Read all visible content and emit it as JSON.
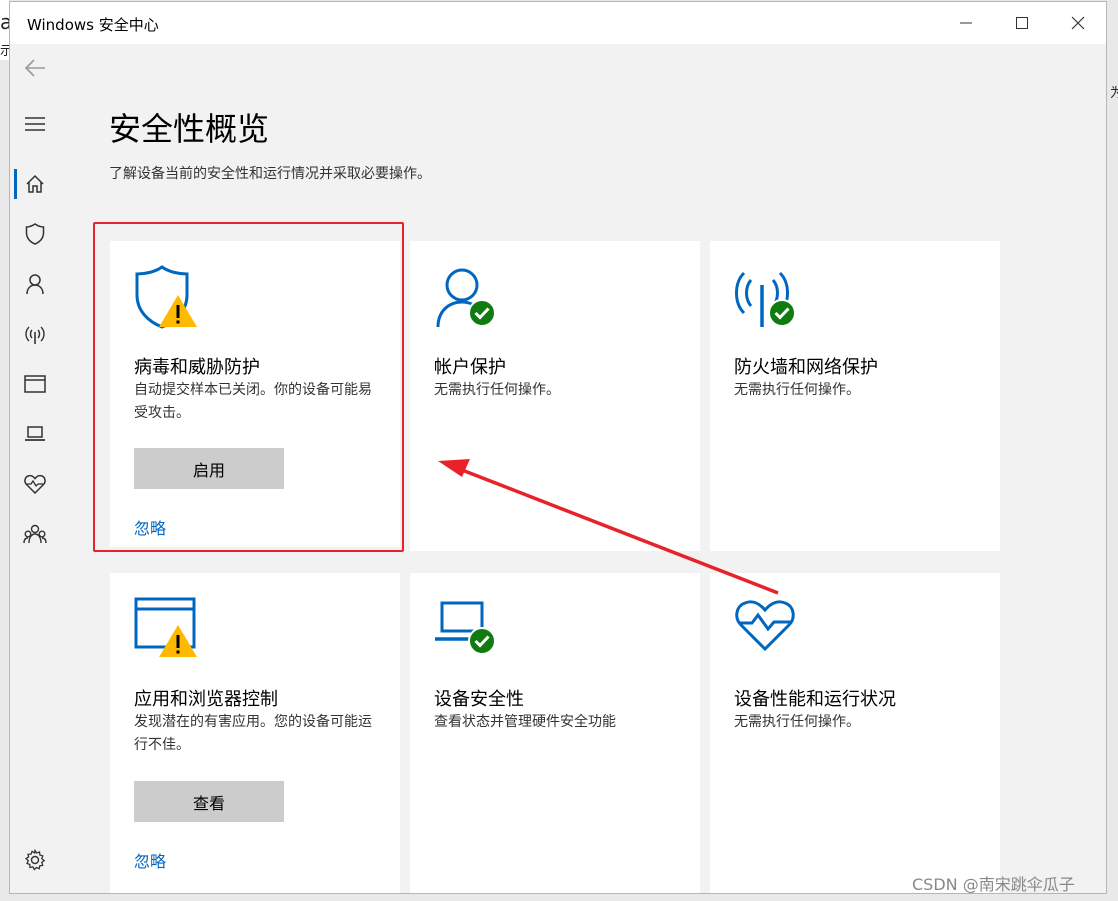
{
  "background": {
    "left_fragments": [
      "a",
      "示"
    ],
    "right_fragments": [
      "为"
    ]
  },
  "window": {
    "title": "Windows 安全中心",
    "controls": [
      "minimize-icon",
      "maximize-icon",
      "close-icon"
    ]
  },
  "sidebar": {
    "items": [
      {
        "name": "back",
        "icon": "back-arrow-icon"
      },
      {
        "name": "menu",
        "icon": "hamburger-menu-icon"
      },
      {
        "name": "home",
        "icon": "home-icon",
        "selected": true
      },
      {
        "name": "virus-protection",
        "icon": "shield-icon"
      },
      {
        "name": "account-protection",
        "icon": "person-icon"
      },
      {
        "name": "firewall",
        "icon": "wireless-antenna-icon"
      },
      {
        "name": "app-browser",
        "icon": "browser-window-icon"
      },
      {
        "name": "device-security",
        "icon": "laptop-icon"
      },
      {
        "name": "device-health",
        "icon": "heart-pulse-icon"
      },
      {
        "name": "family",
        "icon": "family-group-icon"
      },
      {
        "name": "settings",
        "icon": "gear-icon"
      }
    ]
  },
  "page": {
    "title": "安全性概览",
    "subtitle": "了解设备当前的安全性和运行情况并采取必要操作。"
  },
  "cards": [
    {
      "title": "病毒和威胁防护",
      "description": "自动提交样本已关闭。你的设备可能易受攻击。",
      "button": "启用",
      "link": "忽略",
      "icon": "shield-warning-icon",
      "status": "warning"
    },
    {
      "title": "帐户保护",
      "description": "无需执行任何操作。",
      "icon": "person-check-icon",
      "status": "ok"
    },
    {
      "title": "防火墙和网络保护",
      "description": "无需执行任何操作。",
      "icon": "antenna-check-icon",
      "status": "ok"
    },
    {
      "title": "应用和浏览器控制",
      "description": "发现潜在的有害应用。您的设备可能运行不佳。",
      "button": "查看",
      "link": "忽略",
      "icon": "browser-warning-icon",
      "status": "warning"
    },
    {
      "title": "设备安全性",
      "description": "查看状态并管理硬件安全功能",
      "icon": "laptop-check-icon",
      "status": "ok"
    },
    {
      "title": "设备性能和运行状况",
      "description": "无需执行任何操作。",
      "icon": "heart-pulse-icon",
      "status": "info"
    }
  ],
  "colors": {
    "accent": "#0067c0",
    "ok": "#107c10",
    "warning": "#ffb900",
    "annotation": "#e8222b"
  },
  "watermark": "CSDN @南宋跳伞瓜子"
}
